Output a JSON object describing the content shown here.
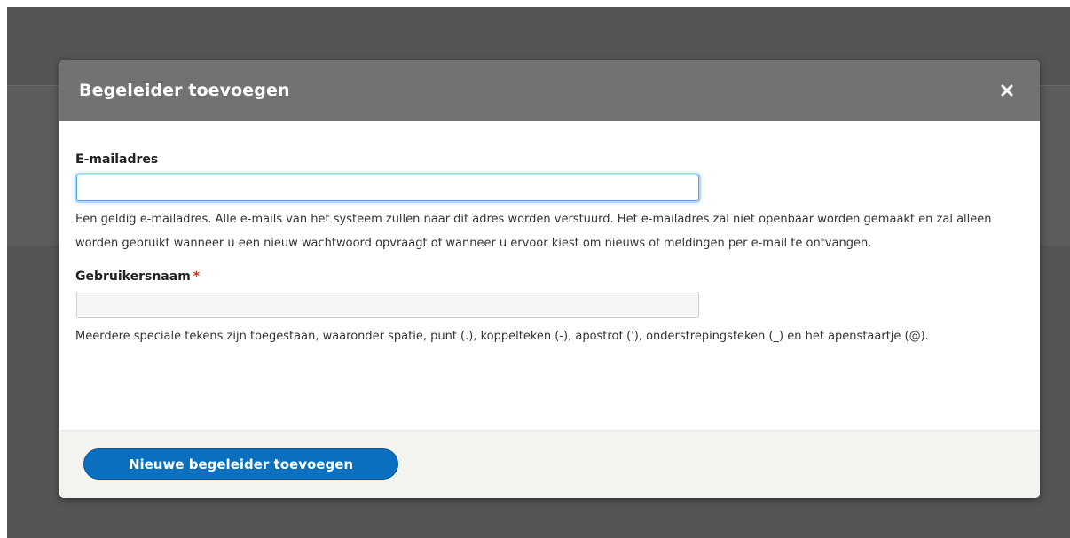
{
  "dialog": {
    "title": "Begeleider toevoegen",
    "close_icon": "close-icon"
  },
  "form": {
    "email": {
      "label": "E-mailadres",
      "value": "",
      "description": "Een geldig e-mailadres. Alle e-mails van het systeem zullen naar dit adres worden verstuurd. Het e-mailadres zal niet openbaar worden gemaakt en zal alleen worden gebruikt wanneer u een nieuw wachtwoord opvraagt of wanneer u ervoor kiest om nieuws of meldingen per e-mail te ontvangen."
    },
    "username": {
      "label": "Gebruikersnaam",
      "required_marker": "*",
      "value": "",
      "description": "Meerdere speciale tekens zijn toegestaan, waaronder spatie, punt (.), koppelteken (-), apostrof ('), onderstrepingsteken (_) en het apenstaartje (@)."
    }
  },
  "footer": {
    "submit_label": "Nieuwe begeleider toevoegen"
  },
  "colors": {
    "titlebar": "#727272",
    "button": "#0a6fbe",
    "required": "#e32700",
    "focus": "#5aa3e0"
  }
}
